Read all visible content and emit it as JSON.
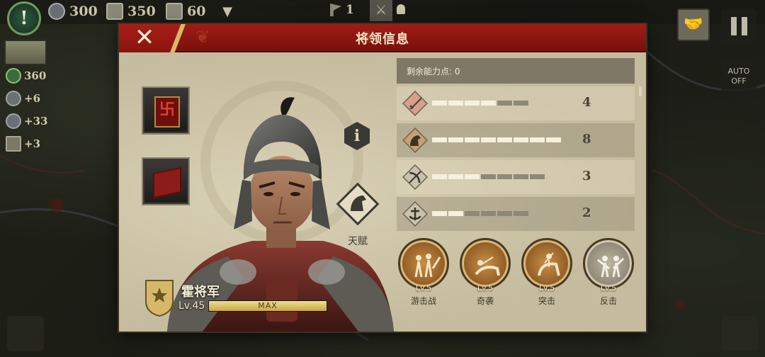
{
  "hud": {
    "resource_silver": "300",
    "resource_hammer": "350",
    "resource_scroll": "60",
    "flag_count": "1",
    "colors": {
      "accent_red": "#a01c16",
      "gold": "#d6b86a",
      "panel_bg": "#c8bfa3"
    }
  },
  "sidebar": {
    "stat_army": "360",
    "stat_people": "+6",
    "stat_silver": "+33",
    "stat_scroll": "+3"
  },
  "controls": {
    "auto_label": "AUTO",
    "auto_state": "OFF"
  },
  "panel": {
    "title": "将领信息",
    "remaining_points_label": "剩余能力点: 0"
  },
  "general": {
    "name": "霍将军",
    "level": "Lv.45",
    "exp_label": "MAX",
    "exp_fraction": 1.0,
    "talent_label": "天赋"
  },
  "stats": [
    {
      "icon": "sword-icon",
      "value": "4",
      "filled": 4,
      "max": 6
    },
    {
      "icon": "horse-icon",
      "value": "8",
      "filled": 8,
      "max": 8
    },
    {
      "icon": "bow-icon",
      "value": "3",
      "filled": 3,
      "max": 7
    },
    {
      "icon": "anchor-icon",
      "value": "2",
      "filled": 2,
      "max": 6
    }
  ],
  "skills": [
    {
      "level": "Lv.5",
      "name": "游击战",
      "tone": "bronze"
    },
    {
      "level": "Lv.5",
      "name": "奇袭",
      "tone": "bronze"
    },
    {
      "level": "Lv.5",
      "name": "突击",
      "tone": "bronze"
    },
    {
      "level": "Lv.5",
      "name": "反击",
      "tone": "grey"
    }
  ]
}
